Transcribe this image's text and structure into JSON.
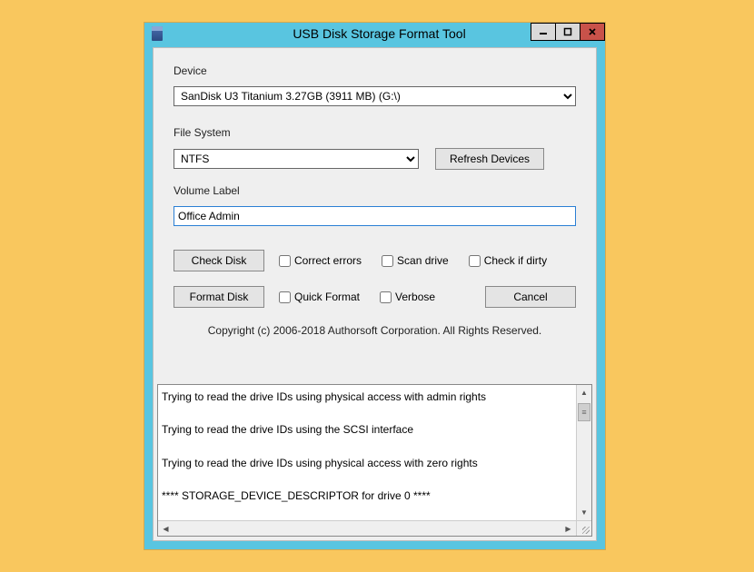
{
  "window": {
    "title": "USB Disk Storage Format Tool"
  },
  "labels": {
    "device": "Device",
    "filesystem": "File System",
    "volume": "Volume Label"
  },
  "device": {
    "selected": "SanDisk U3 Titanium 3.27GB (3911 MB)  (G:\\)"
  },
  "filesystem": {
    "selected": "NTFS"
  },
  "buttons": {
    "refresh": "Refresh Devices",
    "check": "Check Disk",
    "format": "Format Disk",
    "cancel": "Cancel"
  },
  "volume": {
    "value": "Office Admin"
  },
  "checkboxes": {
    "correct": "Correct errors",
    "scan": "Scan drive",
    "dirty": "Check if dirty",
    "quick": "Quick Format",
    "verbose": "Verbose"
  },
  "copyright": "Copyright (c) 2006-2018 Authorsoft Corporation. All Rights Reserved.",
  "log": {
    "l1": "Trying to read the drive IDs using physical access with admin rights",
    "l2": "Trying to read the drive IDs using the SCSI interface",
    "l3": "Trying to read the drive IDs using physical access with zero rights",
    "l4": "**** STORAGE_DEVICE_DESCRIPTOR for drive 0 ****"
  }
}
